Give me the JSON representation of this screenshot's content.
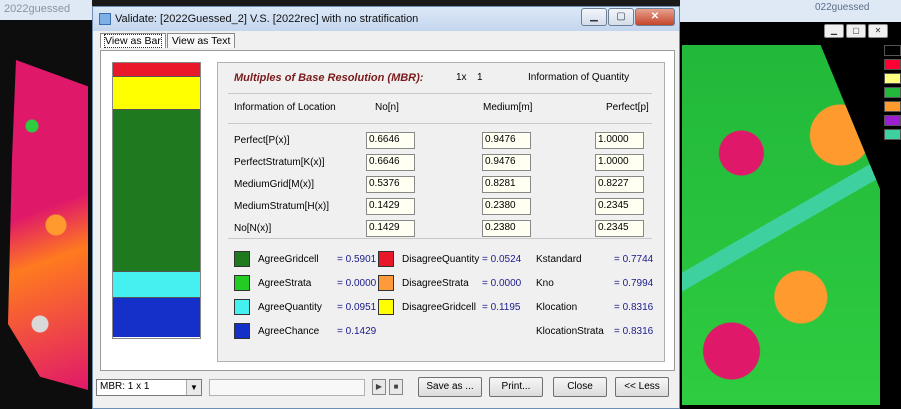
{
  "background": {
    "left_title": "2022guessed",
    "right_title": "022guessed",
    "legend_colors": [
      "#000000",
      "#ff0033",
      "#ffff80",
      "#22b83a",
      "#ff9a2e",
      "#9b1fd1",
      "#3fd0a0"
    ]
  },
  "dialog": {
    "title": "Validate: [2022Guessed_2] V.S. [2022rec] with no stratification",
    "tabs": [
      "View as Bar",
      "View as Text"
    ]
  },
  "bar_segments": [
    {
      "color": "#e8182a",
      "fraction": 0.0524
    },
    {
      "color": "#ffff00",
      "fraction": 0.1195
    },
    {
      "color": "#1f7a1f",
      "fraction": 0.5901
    },
    {
      "color": "#44f0f0",
      "fraction": 0.0951
    },
    {
      "color": "#1530c8",
      "fraction": 0.1429
    }
  ],
  "mbr": {
    "title": "Multiples of Base Resolution (MBR):",
    "x_label": "1x",
    "value": "1",
    "info_quantity": "Information of Quantity"
  },
  "table": {
    "col_location": "Information of Location",
    "col_no": "No[n]",
    "col_medium": "Medium[m]",
    "col_perfect": "Perfect[p]",
    "rows": [
      {
        "label": "Perfect[P(x)]",
        "no": "0.6646",
        "medium": "0.9476",
        "perfect": "1.0000"
      },
      {
        "label": "PerfectStratum[K(x)]",
        "no": "0.6646",
        "medium": "0.9476",
        "perfect": "1.0000"
      },
      {
        "label": "MediumGrid[M(x)]",
        "no": "0.5376",
        "medium": "0.8281",
        "perfect": "0.8227"
      },
      {
        "label": "MediumStratum[H(x)]",
        "no": "0.1429",
        "medium": "0.2380",
        "perfect": "0.2345"
      },
      {
        "label": "No[N(x)]",
        "no": "0.1429",
        "medium": "0.2380",
        "perfect": "0.2345"
      }
    ]
  },
  "legend": {
    "agree": [
      {
        "label": "AgreeGridcell",
        "value": "= 0.5901",
        "color": "#1f7a1f"
      },
      {
        "label": "AgreeStrata",
        "value": "= 0.0000",
        "color": "#22cc22"
      },
      {
        "label": "AgreeQuantity",
        "value": "= 0.0951",
        "color": "#44f0f0"
      },
      {
        "label": "AgreeChance",
        "value": "= 0.1429",
        "color": "#1530c8"
      }
    ],
    "disagree": [
      {
        "label": "DisagreeQuantity",
        "value": "= 0.0524",
        "color": "#e8182a"
      },
      {
        "label": "DisagreeStrata",
        "value": "= 0.0000",
        "color": "#ff9a3a"
      },
      {
        "label": "DisagreeGridcell",
        "value": "= 0.1195",
        "color": "#ffff00"
      }
    ],
    "k_stats": [
      {
        "label": "Kstandard",
        "value": "= 0.7744"
      },
      {
        "label": "Kno",
        "value": "= 0.7994"
      },
      {
        "label": "Klocation",
        "value": "= 0.8316"
      },
      {
        "label": "KlocationStrata",
        "value": "= 0.8316"
      }
    ]
  },
  "footer": {
    "mbr_select": "MBR: 1 x 1",
    "save_as": "Save as ...",
    "print": "Print...",
    "close": "Close",
    "less": "<< Less"
  }
}
